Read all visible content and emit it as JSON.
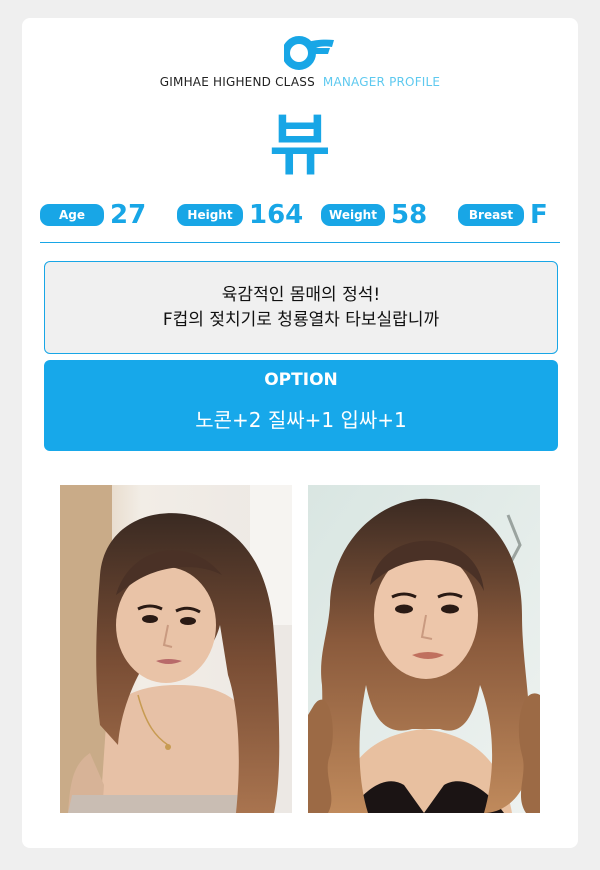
{
  "brand": {
    "name": "GIMHAE HIGHEND CLASS",
    "section": "MANAGER PROFILE"
  },
  "profile": {
    "name": "뷰",
    "stats": [
      {
        "label": "Age",
        "value": "27"
      },
      {
        "label": "Height",
        "value": "164"
      },
      {
        "label": "Weight",
        "value": "58"
      },
      {
        "label": "Breast",
        "value": "F"
      }
    ],
    "description": [
      "육감적인 몸매의 정석!",
      "F컵의 젖치기로 청룡열차 타보실랍니까"
    ]
  },
  "option": {
    "title": "OPTION",
    "text": "노콘+2  질싸+1  입싸+1"
  },
  "photos": [
    {
      "alt": "profile-photo-1"
    },
    {
      "alt": "profile-photo-2"
    }
  ],
  "colors": {
    "accent": "#18a6e6",
    "light_accent": "#5ec9ef",
    "background": "#efefef"
  }
}
